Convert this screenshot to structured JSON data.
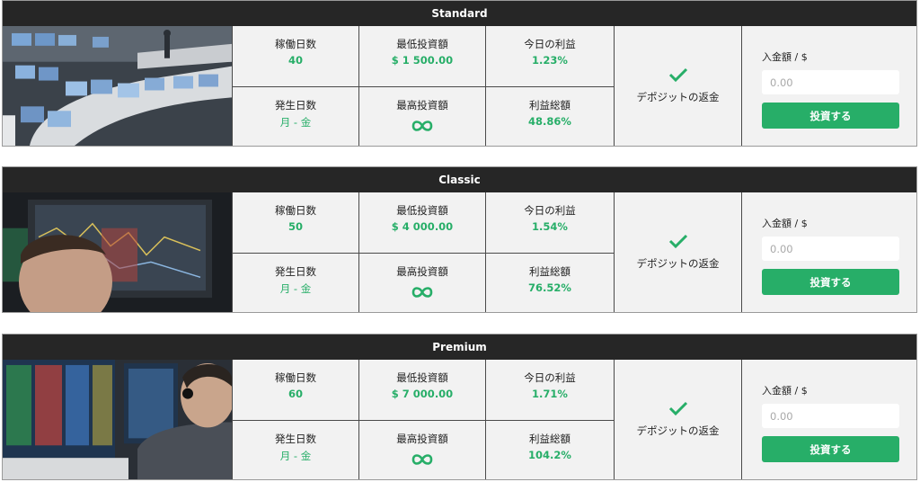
{
  "colors": {
    "accent": "#27ae68",
    "header_bg": "#262626",
    "panel_bg": "#f2f2f2"
  },
  "labels": {
    "working_days": "稼働日数",
    "min_investment": "最低投資額",
    "today_profit": "今日の利益",
    "accrual_days": "発生日数",
    "max_investment": "最高投資額",
    "total_profit": "利益総額",
    "deposit_refund": "デポジットの返金",
    "amount_label": "入金額 / $",
    "amount_placeholder": "0.00",
    "invest_button": "投資する"
  },
  "plans": [
    {
      "name": "Standard",
      "working_days": "40",
      "min_investment": "$ 1 500.00",
      "today_profit": "1.23%",
      "accrual_days": "月 - 金",
      "max_investment_icon": "infinity-icon",
      "total_profit": "48.86%",
      "photo": "trading-floor-photo"
    },
    {
      "name": "Classic",
      "working_days": "50",
      "min_investment": "$ 4 000.00",
      "today_profit": "1.54%",
      "accrual_days": "月 - 金",
      "max_investment_icon": "infinity-icon",
      "total_profit": "76.52%",
      "photo": "trader-monitor-photo"
    },
    {
      "name": "Premium",
      "working_days": "60",
      "min_investment": "$ 7 000.00",
      "today_profit": "1.71%",
      "accrual_days": "月 - 金",
      "max_investment_icon": "infinity-icon",
      "total_profit": "104.2%",
      "photo": "trader-headset-photo"
    }
  ]
}
